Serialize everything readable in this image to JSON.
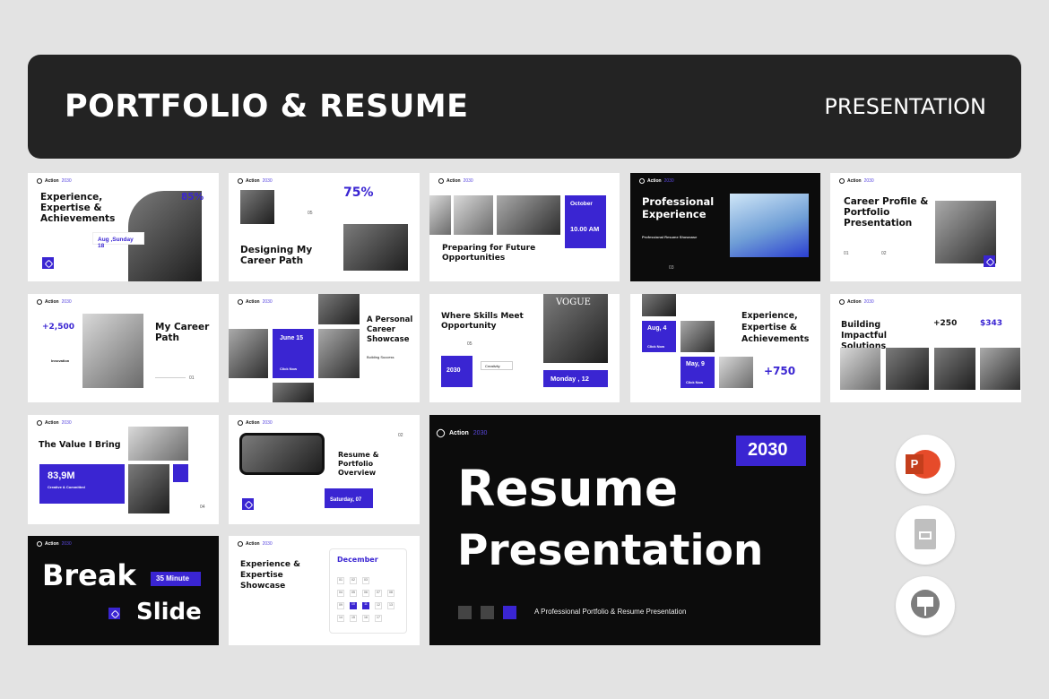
{
  "banner": {
    "title": "PORTFOLIO & RESUME",
    "subtitle": "PRESENTATION"
  },
  "brand": {
    "name": "Action",
    "year": "2030"
  },
  "s1": {
    "title": "Experience, Expertise & Achievements",
    "stat": "85%",
    "date": "Aug ,Sunday 18"
  },
  "s2": {
    "stat": "75%",
    "num": "05",
    "title": "Designing My Career Path"
  },
  "s3": {
    "month": "October",
    "time": "10.00 AM",
    "title": "Preparing for Future Opportunities"
  },
  "s4": {
    "title": "Professional Experience",
    "sub": "Professional Resume Showcase",
    "num": "03"
  },
  "s5": {
    "title": "Career Profile & Portfolio Presentation",
    "n1": "01",
    "n2": "02"
  },
  "s6": {
    "stat": "+2,500",
    "label": "Innovation",
    "title": "My Career Path",
    "num": "01"
  },
  "s7": {
    "date": "June 15",
    "btn": "Click Now",
    "title": "A Personal Career Showcase",
    "label": "Building Success"
  },
  "s8": {
    "title": "Where Skills Meet Opportunity",
    "num": "05",
    "year": "2030",
    "pill": "Creativity",
    "date": "Monday , 12",
    "mag": "VOGUE"
  },
  "s9": {
    "d1": "Aug, 4",
    "d2": "May, 9",
    "btn": "Click Now",
    "title": "Experience, Expertise & Achievements",
    "stat": "+750"
  },
  "s10": {
    "title": "Building Impactful Solutions",
    "s1": "+250",
    "s2": "$343"
  },
  "s11": {
    "title": "The Value I Bring",
    "stat": "83,9M",
    "label": "Creative & Committed",
    "num": "04"
  },
  "s12": {
    "title": "Resume & Portfolio Overview",
    "num": "02",
    "date": "Saturday, 07"
  },
  "s13": {
    "break": "Break",
    "slide": "Slide",
    "minute": "35 Minute"
  },
  "s14": {
    "title": "Experience & Expertise Showcase",
    "month": "December",
    "days": [
      "01",
      "02",
      "03",
      "04",
      "05",
      "06",
      "07",
      "08",
      "09",
      "10",
      "11",
      "12",
      "13",
      "14",
      "15",
      "16",
      "17"
    ]
  },
  "hero": {
    "year": "2030",
    "line1": "Resume",
    "line2": "Presentation",
    "tag": "A Professional Portfolio & Resume Presentation"
  },
  "apps": [
    "powerpoint-icon",
    "google-slides-icon",
    "keynote-icon"
  ],
  "colors": {
    "accent": "#3a25d2",
    "dark": "#0c0c0c"
  }
}
